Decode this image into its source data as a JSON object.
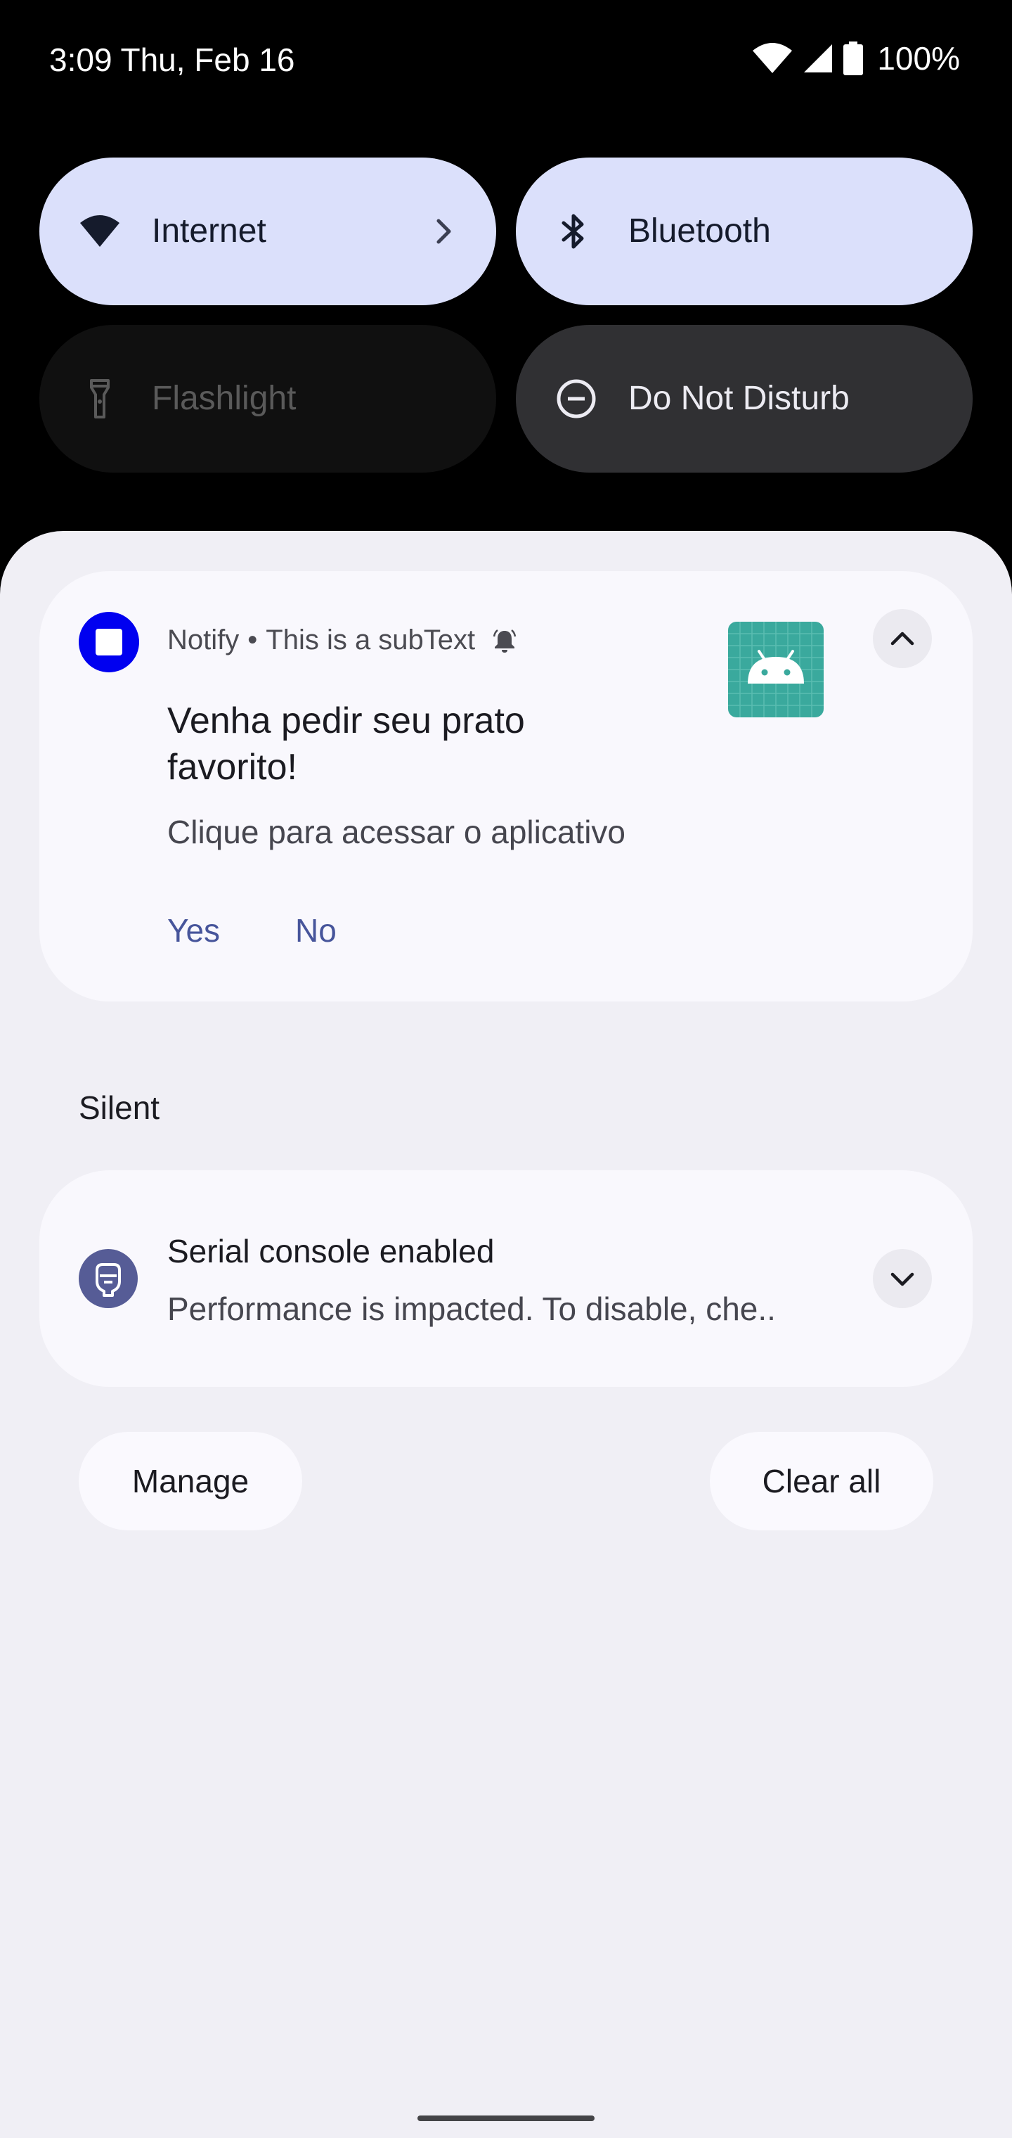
{
  "status_bar": {
    "time": "3:09 Thu, Feb 16",
    "battery": "100%",
    "icons": [
      "wifi-icon",
      "cellular-signal-icon",
      "battery-icon"
    ]
  },
  "quick_tiles": [
    {
      "label": "Internet",
      "icon": "wifi-icon",
      "state": "on"
    },
    {
      "label": "Bluetooth",
      "icon": "bluetooth-icon",
      "state": "on"
    },
    {
      "label": "Flashlight",
      "icon": "flashlight-icon",
      "state": "unavailable"
    },
    {
      "label": "Do Not Disturb",
      "icon": "do-not-disturb-icon",
      "state": "off"
    }
  ],
  "notification": {
    "app_name": "Notify",
    "sub_text": "This is a subText",
    "separator": "•",
    "title": "Venha pedir seu prato favorito!",
    "text": "Clique para acessar o aplicativo",
    "actions": [
      "Yes",
      "No"
    ],
    "large_icon": "android-icon",
    "app_icon_color": "#0000f0"
  },
  "silent_section": {
    "header": "Silent",
    "notification": {
      "title": "Serial console enabled",
      "text": "Performance is impacted. To disable, che.."
    }
  },
  "footer": {
    "manage_label": "Manage",
    "clear_all_label": "Clear all"
  },
  "colors": {
    "accent_tile": "#dbe0fb",
    "action_text": "#47559b",
    "shade_bg": "#f0eff5"
  }
}
